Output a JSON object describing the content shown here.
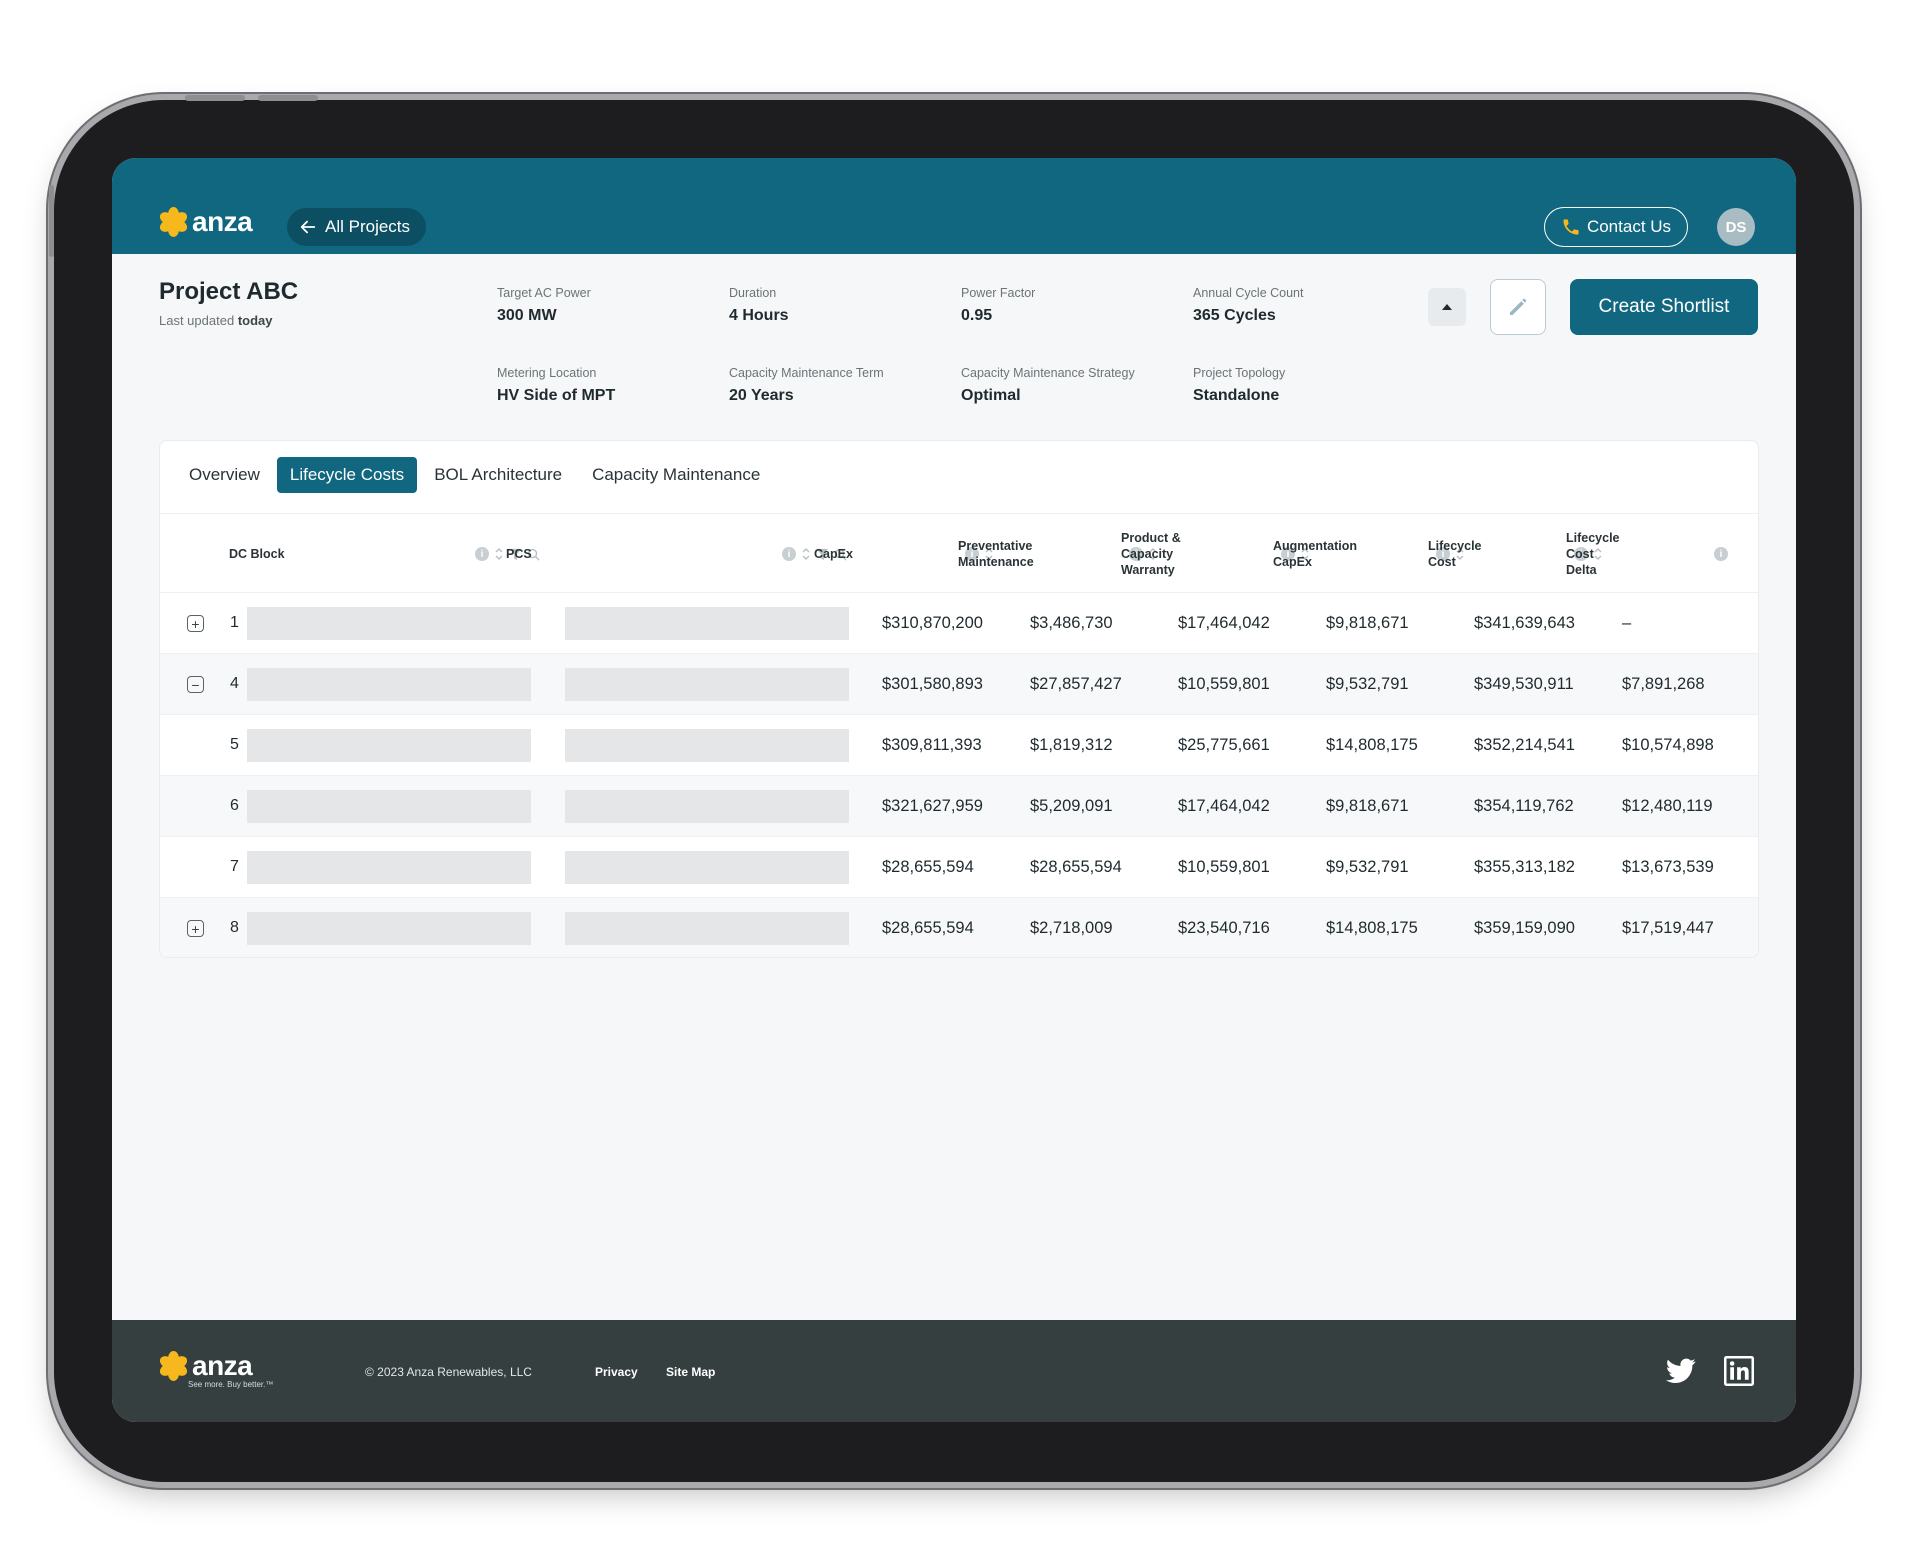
{
  "header": {
    "logo_text": "anza",
    "all_projects_label": "All Projects",
    "contact_label": "Contact Us",
    "avatar_initials": "DS",
    "brand_color": "#11677f",
    "accent_color": "#f6b81c"
  },
  "project": {
    "title": "Project ABC",
    "updated_prefix": "Last updated",
    "updated_value": "today",
    "meta": [
      {
        "label": "Target AC Power",
        "value": "300 MW"
      },
      {
        "label": "Duration",
        "value": "4 Hours"
      },
      {
        "label": "Power Factor",
        "value": "0.95"
      },
      {
        "label": "Annual Cycle Count",
        "value": "365 Cycles"
      },
      {
        "label": "Metering Location",
        "value": "HV Side of MPT"
      },
      {
        "label": "Capacity Maintenance Term",
        "value": "20 Years"
      },
      {
        "label": "Capacity Maintenance Strategy",
        "value": "Optimal"
      },
      {
        "label": "Project Topology",
        "value": "Standalone"
      }
    ],
    "create_label": "Create Shortlist"
  },
  "tabs": [
    {
      "label": "Overview",
      "active": false
    },
    {
      "label": "Lifecycle Costs",
      "active": true
    },
    {
      "label": "BOL Architecture",
      "active": false
    },
    {
      "label": "Capacity Maintenance",
      "active": false
    }
  ],
  "table": {
    "columns": [
      {
        "line1": "DC Block"
      },
      {
        "line1": "PCS"
      },
      {
        "line1": "CapEx"
      },
      {
        "line1": "Preventative",
        "line2": "Maintenance"
      },
      {
        "line1": "Product &",
        "line2": "Capacity",
        "line3": "Warranty"
      },
      {
        "line1": "Augmentation",
        "line2": "CapEx"
      },
      {
        "line1": "Lifecycle",
        "line2": "Cost"
      },
      {
        "line1": "Lifecycle",
        "line2": "Cost",
        "line3": "Delta"
      }
    ],
    "rows": [
      {
        "expander": "+",
        "block": "1",
        "values": [
          "$310,870,200",
          "$3,486,730",
          "$17,464,042",
          "$9,818,671",
          "$341,639,643",
          "–"
        ]
      },
      {
        "expander": "−",
        "block": "4",
        "values": [
          "$301,580,893",
          "$27,857,427",
          "$10,559,801",
          "$9,532,791",
          "$349,530,911",
          "$7,891,268"
        ]
      },
      {
        "expander": "",
        "block": "5",
        "values": [
          "$309,811,393",
          "$1,819,312",
          "$25,775,661",
          "$14,808,175",
          "$352,214,541",
          "$10,574,898"
        ]
      },
      {
        "expander": "",
        "block": "6",
        "values": [
          "$321,627,959",
          "$5,209,091",
          "$17,464,042",
          "$9,818,671",
          "$354,119,762",
          "$12,480,119"
        ]
      },
      {
        "expander": "",
        "block": "7",
        "values": [
          "$28,655,594",
          "$28,655,594",
          "$10,559,801",
          "$9,532,791",
          "$355,313,182",
          "$13,673,539"
        ]
      },
      {
        "expander": "+",
        "block": "8",
        "values": [
          "$28,655,594",
          "$2,718,009",
          "$23,540,716",
          "$14,808,175",
          "$359,159,090",
          "$17,519,447"
        ]
      }
    ]
  },
  "footer": {
    "logo_text": "anza",
    "tagline": "See more. Buy better.™",
    "copyright": "© 2023 Anza Renewables, LLC",
    "privacy_label": "Privacy",
    "sitemap_label": "Site Map"
  }
}
